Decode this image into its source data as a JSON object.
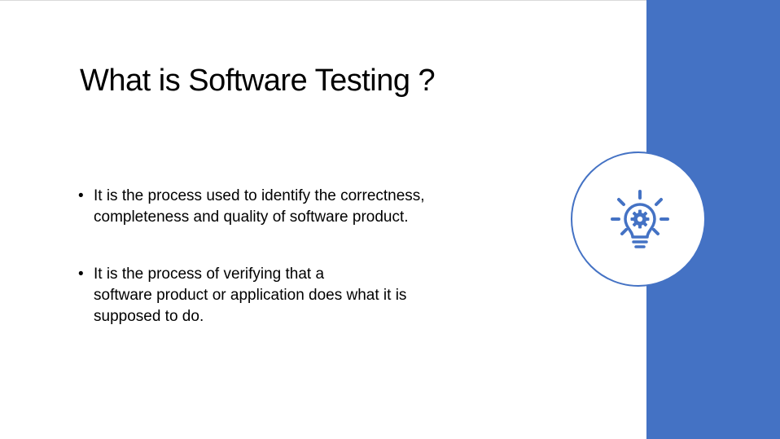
{
  "slide": {
    "title": "What is Software Testing ?",
    "bullet_symbol": "•",
    "bullets": [
      {
        "lines": [
          "It is the process used to identify the correctness,",
          "completeness and quality of  software product."
        ]
      },
      {
        "lines": [
          "It is the process of verifying that a",
          "software product or application does what it is",
          "supposed to do."
        ]
      }
    ],
    "icon": "lightbulb-gear-icon"
  },
  "colors": {
    "accent": "#4472c4",
    "text": "#000000",
    "background": "#ffffff"
  }
}
